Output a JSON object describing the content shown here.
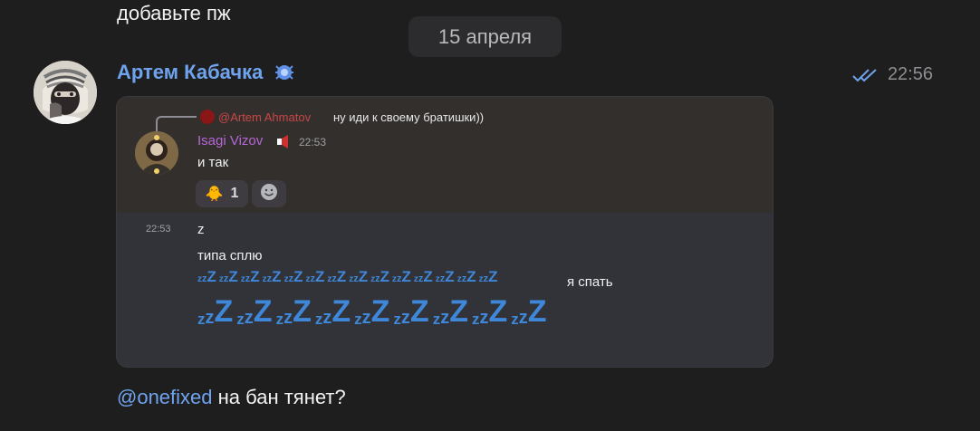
{
  "previous_message": {
    "text": "добавьте пж"
  },
  "date_separator": {
    "label": "15 апреля"
  },
  "message": {
    "sender": "Артем Кабачка",
    "time": "22:56",
    "status": "read",
    "sender_badge_icon": "spider-icon"
  },
  "screenshot": {
    "reply": {
      "mention": "@Artem Ahmatov",
      "text": "ну иди к своему братишки))"
    },
    "author": "Isagi Vizov",
    "time": "22:53",
    "text": "и так",
    "reaction": {
      "emoji": "🐥",
      "count": "1"
    },
    "followups": [
      {
        "time": "22:53",
        "text": "z"
      },
      {
        "text": "типа сплю"
      }
    ],
    "sleep_small_count": 14,
    "sleep_label": "я спать",
    "sleep_big_count": 9,
    "zzz_text": "zzZ"
  },
  "bottom_message": {
    "mention": "@onefixed",
    "text": " на бан тянет?"
  },
  "colors": {
    "background": "#1e1e1e",
    "accent": "#6fa3ee",
    "inner_name": "#b567d8",
    "zzz": "#3f87d8"
  }
}
